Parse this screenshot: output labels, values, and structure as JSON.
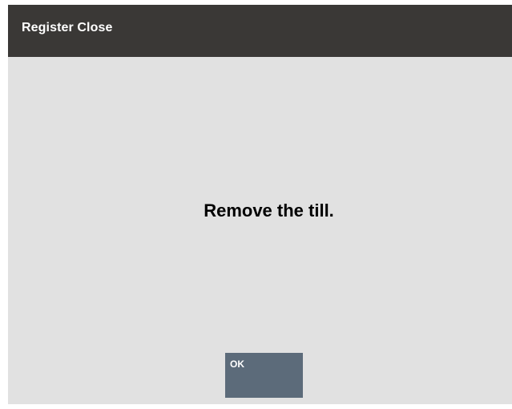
{
  "window": {
    "title": "Register Close"
  },
  "dialog": {
    "message": "Remove the till."
  },
  "actions": {
    "ok_label": "OK"
  },
  "colors": {
    "title_bar": "#3a3836",
    "background": "#e1e1e1",
    "button": "#5c6b7a",
    "title_text": "#ffffff",
    "message_text": "#000000"
  }
}
